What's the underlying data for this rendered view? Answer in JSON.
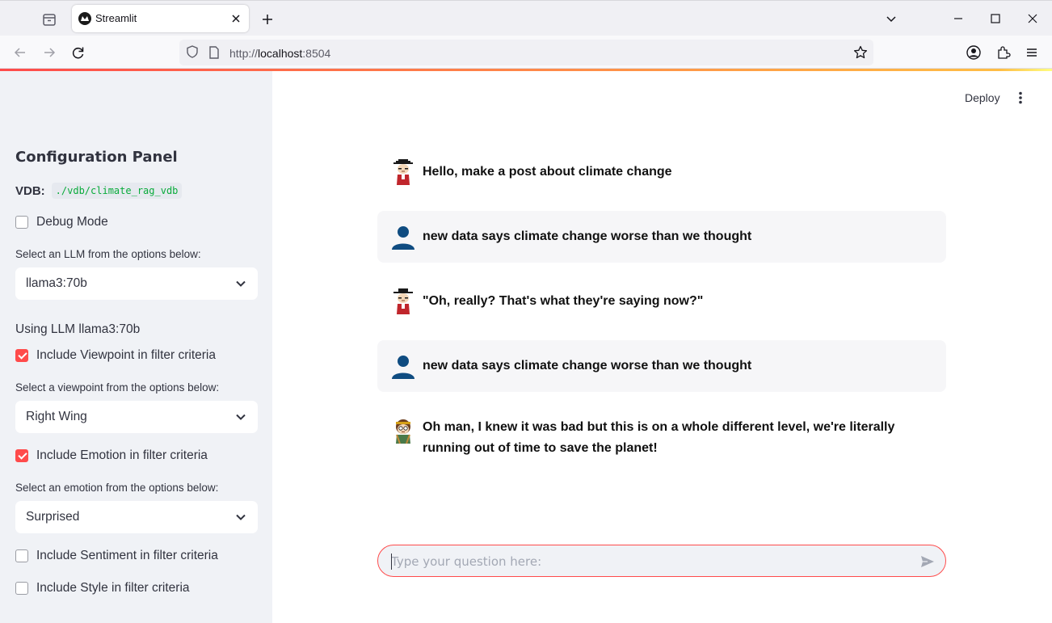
{
  "browser": {
    "tab_title": "Streamlit",
    "url_prefix": "http://",
    "url_host": "localhost",
    "url_port": ":8504"
  },
  "sidebar": {
    "title": "Configuration Panel",
    "vdb_label": "VDB:",
    "vdb_path": "./vdb/climate_rag_vdb",
    "debug_mode": {
      "label": "Debug Mode",
      "checked": false
    },
    "llm_select": {
      "label": "Select an LLM from the options below:",
      "value": "llama3:70b"
    },
    "using_llm": "Using LLM llama3:70b",
    "viewpoint_filter": {
      "label": "Include Viewpoint in filter criteria",
      "checked": true
    },
    "viewpoint_select": {
      "label": "Select a viewpoint from the options below:",
      "value": "Right Wing"
    },
    "emotion_filter": {
      "label": "Include Emotion in filter criteria",
      "checked": true
    },
    "emotion_select": {
      "label": "Select an emotion from the options below:",
      "value": "Surprised"
    },
    "sentiment_filter": {
      "label": "Include Sentiment in filter criteria",
      "checked": false
    },
    "style_filter": {
      "label": "Include Style in filter criteria",
      "checked": false
    }
  },
  "header": {
    "deploy_label": "Deploy"
  },
  "chat": {
    "messages": [
      {
        "role": "assistant",
        "avatar": "cartoon-hat-character-icon",
        "text": "Hello, make a post about climate change"
      },
      {
        "role": "user",
        "avatar": "user-silhouette-icon",
        "text": "new data says climate change worse than we thought"
      },
      {
        "role": "assistant",
        "avatar": "cartoon-hat-character-icon",
        "text": "\"Oh, really? That's what they're saying now?\""
      },
      {
        "role": "user",
        "avatar": "user-silhouette-icon",
        "text": "new data says climate change worse than we thought"
      },
      {
        "role": "assistant",
        "avatar": "cartoon-headband-character-icon",
        "text_line1": "Oh man, I knew it was bad but this is on a whole different level, we're literally",
        "text_line2": "running out of time to save the planet!"
      }
    ],
    "input_placeholder": "Type your question here:"
  },
  "colors": {
    "accent": "#ff4b4b",
    "sidebar_bg": "#f0f2f6",
    "user_msg_bg": "#f6f6f8",
    "code_green": "#09ab3b"
  }
}
